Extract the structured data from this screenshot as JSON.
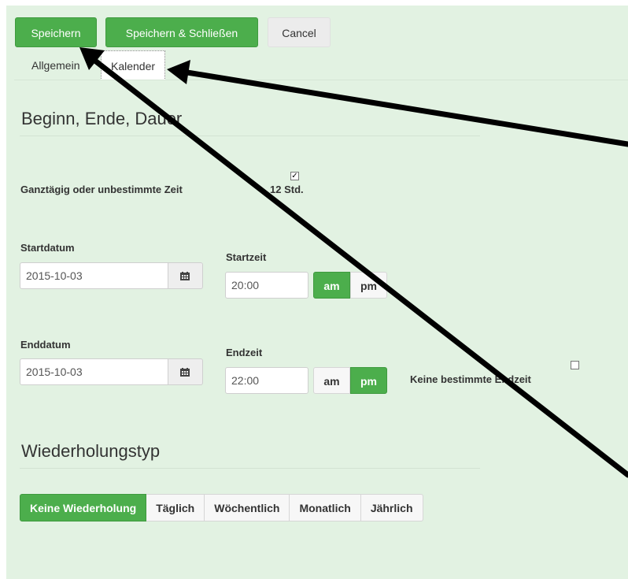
{
  "toolbar": {
    "save_label": "Speichern",
    "save_close_label": "Speichern & Schließen",
    "cancel_label": "Cancel"
  },
  "tabs": [
    {
      "label": "Allgemein"
    },
    {
      "label": "Kalender"
    }
  ],
  "time_section": {
    "heading": "Beginn, Ende, Dauer",
    "allday_label": "Ganztägig oder unbestimmte Zeit",
    "twelve_hour_label": "12 Std.",
    "twelve_hour_checked": true,
    "start_date_label": "Startdatum",
    "start_date_value": "2015-10-03",
    "start_time_label": "Startzeit",
    "start_time_value": "20:00",
    "start_ampm_selected": "am",
    "end_date_label": "Enddatum",
    "end_date_value": "2015-10-03",
    "end_time_label": "Endzeit",
    "end_time_value": "22:00",
    "end_ampm_selected": "pm",
    "am_label": "am",
    "pm_label": "pm",
    "no_end_label": "Keine bestimmte Endzeit",
    "no_end_checked": false
  },
  "repeat_section": {
    "heading": "Wiederholungstyp",
    "options": [
      {
        "label": "Keine Wiederholung",
        "selected": true
      },
      {
        "label": "Täglich",
        "selected": false
      },
      {
        "label": "Wöchentlich",
        "selected": false
      },
      {
        "label": "Monatlich",
        "selected": false
      },
      {
        "label": "Jährlich",
        "selected": false
      }
    ]
  },
  "colors": {
    "panel_bg": "#e2f2e2",
    "accent_green": "#4cae4c",
    "annotation_arrow": "#000000"
  },
  "icons": {
    "date_picker": "calendar-icon",
    "checkmark": "check-icon"
  }
}
